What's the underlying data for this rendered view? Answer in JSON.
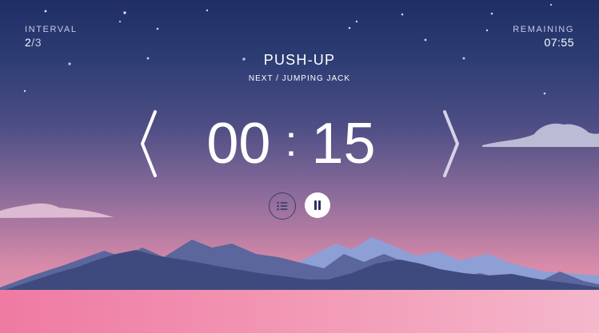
{
  "interval": {
    "caption": "INTERVAL",
    "current": "2",
    "separator": "/",
    "total": "3"
  },
  "remaining": {
    "caption": "REMAINING",
    "value": "07:55"
  },
  "exercise": {
    "title": "PUSH-UP",
    "next": "NEXT / JUMPING JACK"
  },
  "timer": {
    "minutes": "00",
    "separator": ":",
    "seconds": "15"
  },
  "icons": {
    "previous": "chevron-left-icon",
    "next": "chevron-right-icon",
    "list": "list-icon",
    "pause": "pause-icon"
  },
  "colors": {
    "sky_top": "#1f2f66",
    "sky_bottom": "#ee99b5",
    "mountain_far": "#8e9fd6",
    "mountain_mid": "#4c5a90",
    "mountain_front": "#3e4a7e",
    "water": "#f39bb7",
    "accent_dark": "#3b3e70"
  }
}
